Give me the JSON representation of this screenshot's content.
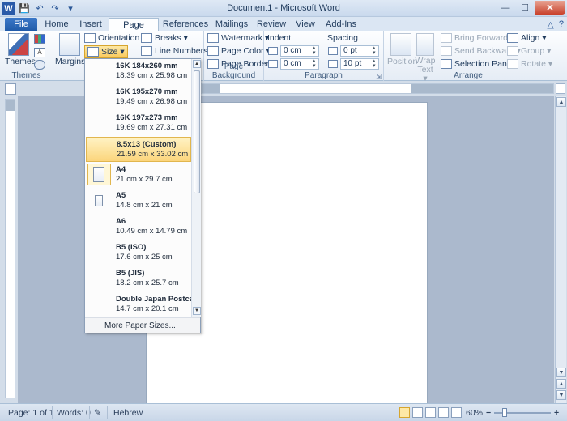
{
  "window": {
    "title": "Document1 - Microsoft Word",
    "app_icon": "W",
    "qat": {
      "save_icon": "💾",
      "undo_icon": "↶",
      "redo_icon": "↷",
      "customize_icon": "▾"
    },
    "controls": {
      "minimize": "—",
      "maximize": "☐",
      "close": "✕"
    }
  },
  "tabs": [
    {
      "label": "File"
    },
    {
      "label": "Home"
    },
    {
      "label": "Insert"
    },
    {
      "label": "Page Layout"
    },
    {
      "label": "References"
    },
    {
      "label": "Mailings"
    },
    {
      "label": "Review"
    },
    {
      "label": "View"
    },
    {
      "label": "Add-Ins"
    }
  ],
  "active_tab": "Page Layout",
  "tab_right": {
    "minimize_ribbon": "△",
    "help": "?"
  },
  "ribbon": {
    "themes": {
      "button": "Themes",
      "group_label": "Themes"
    },
    "page_setup": {
      "margins": "Margins",
      "orientation": "Orientation ▾",
      "size": "Size ▾",
      "breaks": "Breaks ▾",
      "line_numbers": "Line Numbers ▾"
    },
    "page_background": {
      "watermark": "Watermark ▾",
      "page_color": "Page Color ▾",
      "page_borders": "Page Borders",
      "group_label": "Page Background"
    },
    "paragraph": {
      "indent_label": "Indent",
      "spacing_label": "Spacing",
      "indent_left": "0 cm",
      "indent_right": "0 cm",
      "spacing_before": "0 pt",
      "spacing_after": "10 pt",
      "group_label": "Paragraph",
      "launcher": "⇲"
    },
    "arrange": {
      "position": "Position",
      "wrap_text": "Wrap",
      "wrap_text2": "Text ▾",
      "bring_forward": "Bring Forward ▾",
      "send_backward": "Send Backward ▾",
      "selection_pane": "Selection Pane",
      "align": "Align ▾",
      "group": "Group ▾",
      "rotate": "Rotate ▾",
      "group_label": "Arrange"
    }
  },
  "size_menu": {
    "items": [
      {
        "name": "16K 184x260 mm",
        "dims": "18.39 cm x 25.98 cm"
      },
      {
        "name": "16K 195x270 mm",
        "dims": "19.49 cm x 26.98 cm"
      },
      {
        "name": "16K 197x273 mm",
        "dims": "19.69 cm x 27.31 cm"
      },
      {
        "name": "8.5x13 (Custom)",
        "dims": "21.59 cm x 33.02 cm"
      },
      {
        "name": "A4",
        "dims": "21 cm x 29.7 cm"
      },
      {
        "name": "A5",
        "dims": "14.8 cm x 21 cm"
      },
      {
        "name": "A6",
        "dims": "10.49 cm x 14.79 cm"
      },
      {
        "name": "B5 (ISO)",
        "dims": "17.6 cm x 25 cm"
      },
      {
        "name": "B5 (JIS)",
        "dims": "18.2 cm x 25.7 cm"
      },
      {
        "name": "Double Japan Postcard",
        "dims": "14.7 cm x 20.1 cm"
      }
    ],
    "highlighted": "8.5x13 (Custom)",
    "selected": "A4",
    "more": "More Paper Sizes..."
  },
  "status": {
    "page": "Page: 1 of 1",
    "words": "Words: 0",
    "language": "Hebrew",
    "zoom": "60%",
    "zoom_out": "−",
    "zoom_in": "+"
  }
}
